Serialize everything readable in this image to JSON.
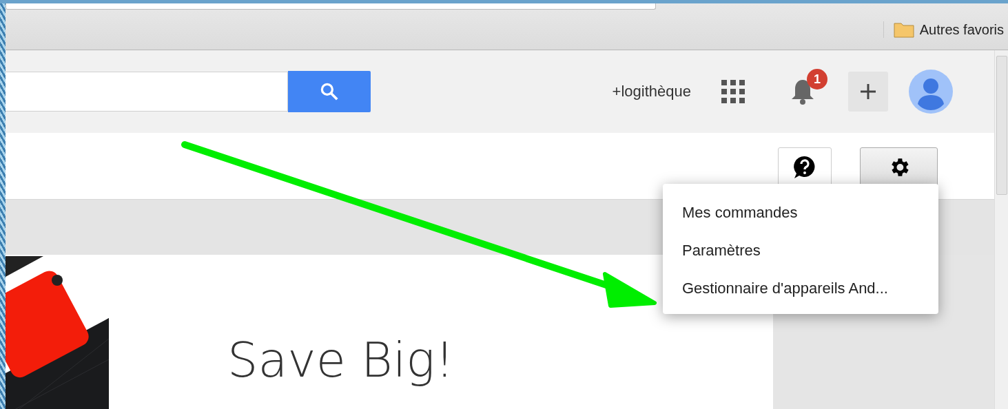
{
  "bookmarks_bar": {
    "items": [
      {
        "label": "Autres favoris"
      }
    ]
  },
  "header": {
    "library_link": "+logithèque",
    "notifications": {
      "count": "1"
    }
  },
  "settings_menu": {
    "open": true,
    "items": [
      {
        "label": "Mes commandes"
      },
      {
        "label": "Paramètres"
      },
      {
        "label": "Gestionnaire d'appareils And..."
      }
    ]
  },
  "banner": {
    "headline": "Save Big!"
  }
}
